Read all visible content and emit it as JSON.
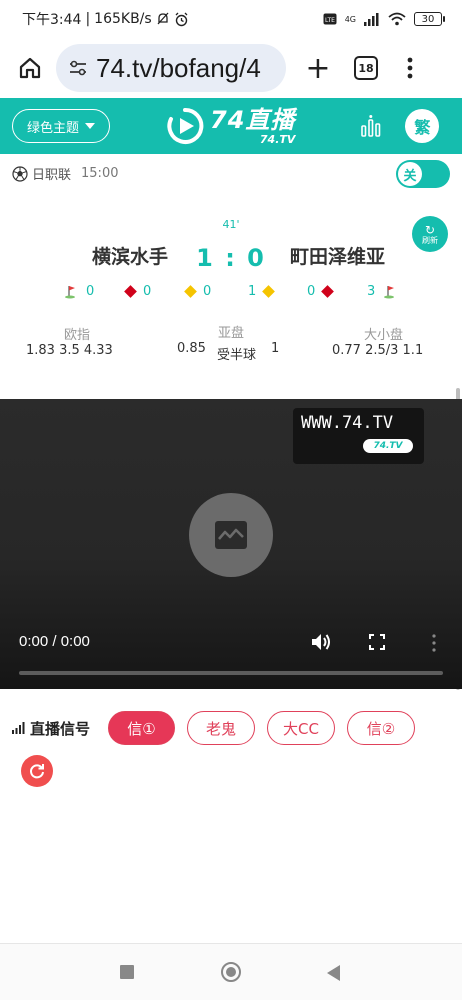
{
  "status_bar": {
    "time": "下午3:44",
    "separator": "|",
    "speed": "165KB/s",
    "network_label": "4G",
    "battery": "30"
  },
  "browser": {
    "url": "74.tv/bofang/4",
    "tab_count": "18",
    "new_tab_label": "+"
  },
  "header": {
    "theme_label": "绿色主题",
    "logo_main": "74直播",
    "logo_sub": "74.TV",
    "trad_label": "繁",
    "accent_color": "#15bdae"
  },
  "match": {
    "league": "日职联",
    "time": "15:00",
    "toggle_label": "关",
    "minute": "41'",
    "home_team": "横滨水手",
    "away_team": "町田泽维亚",
    "score": "1 : 0",
    "refresh_label": "刷新",
    "stats": {
      "home_corners": "0",
      "home_red": "0",
      "home_yellow": "0",
      "away_yellow": "1",
      "away_red": "0",
      "away_corners": "3"
    },
    "odds": {
      "euro_label": "欧指",
      "euro_values": "1.83  3.5  4.33",
      "asian_label": "亚盘",
      "asian_home": "0.85",
      "asian_line": "受半球",
      "asian_away": "1",
      "ou_label": "大小盘",
      "ou_values": "0.77  2.5/3  1.1"
    }
  },
  "video": {
    "watermark": "WWW.74.TV",
    "watermark_badge": "74.TV",
    "time": "0:00 / 0:00",
    "progress": 0
  },
  "signals": {
    "label": "直播信号",
    "buttons": [
      "信①",
      "老鬼",
      "大CC",
      "信②"
    ],
    "active_index": 0,
    "active_color": "#e63757"
  }
}
